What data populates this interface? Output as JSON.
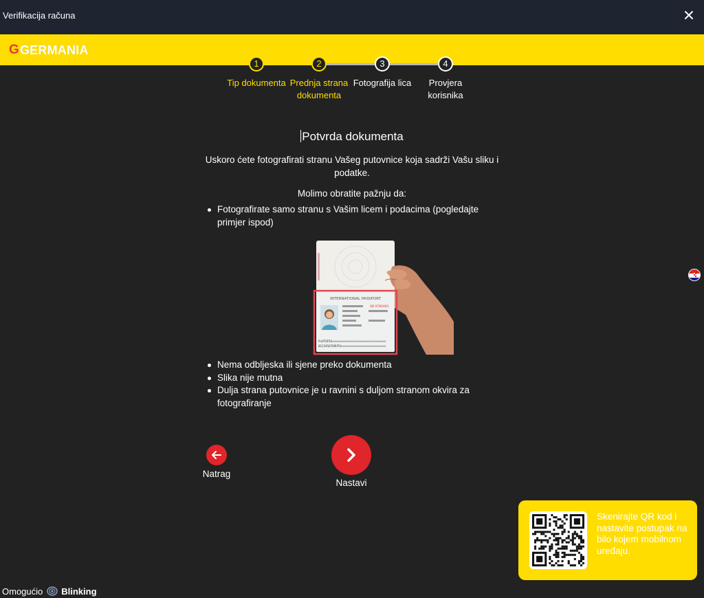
{
  "window": {
    "title": "Verifikacija računa",
    "close_icon": "close-icon"
  },
  "brand": {
    "mark": "G",
    "name": "GERMANIA",
    "color": "#ffdd00",
    "accent": "#e53935"
  },
  "steps": [
    {
      "number": "1",
      "label": "Tip dokumenta",
      "state": "done"
    },
    {
      "number": "2",
      "label": "Prednja strana dokumenta",
      "state": "current"
    },
    {
      "number": "3",
      "label": "Fotografija lica",
      "state": "todo"
    },
    {
      "number": "4",
      "label": "Provjera korisnika",
      "state": "todo"
    }
  ],
  "main": {
    "heading": "Potvrda dokumenta",
    "intro": "Uskoro ćete fotografirati stranu Vašeg putovnice koja sadrži Vašu sliku i podatke.",
    "note": "Molimo obratite pažnju da:",
    "bullets_top": [
      "Fotografirate samo stranu s Vašim licem i podacima (pogledajte primjer ispod)"
    ],
    "passport_image": {
      "header": "INTERNATIONAL PASSPORT",
      "number": "AB 9760481",
      "mrz_1": "P<UTOPIA<<<<<<<<<<<<<<<<<<<<<<<<<<<<<<<",
      "mrz_2": "0123456789UTO<<<<<<<<<<<<<<<<<<<<<<<<<<"
    },
    "bullets_bottom": [
      "Nema odbljeska ili sjene preko dokumenta",
      "Slika nije mutna",
      "Dulja strana putovnice je u ravnini s duljom stranom okvira za fotografiranje"
    ]
  },
  "nav": {
    "back_label": "Natrag",
    "next_label": "Nastavi",
    "button_color": "#e0252b"
  },
  "language": {
    "flag": "croatia-flag-icon"
  },
  "qr": {
    "text": "Skenirajte QR kod i nastavite postupak na bilo kojem mobilnom uređaju."
  },
  "footer": {
    "powered_by": "Omogućio",
    "provider": "Blinking"
  }
}
